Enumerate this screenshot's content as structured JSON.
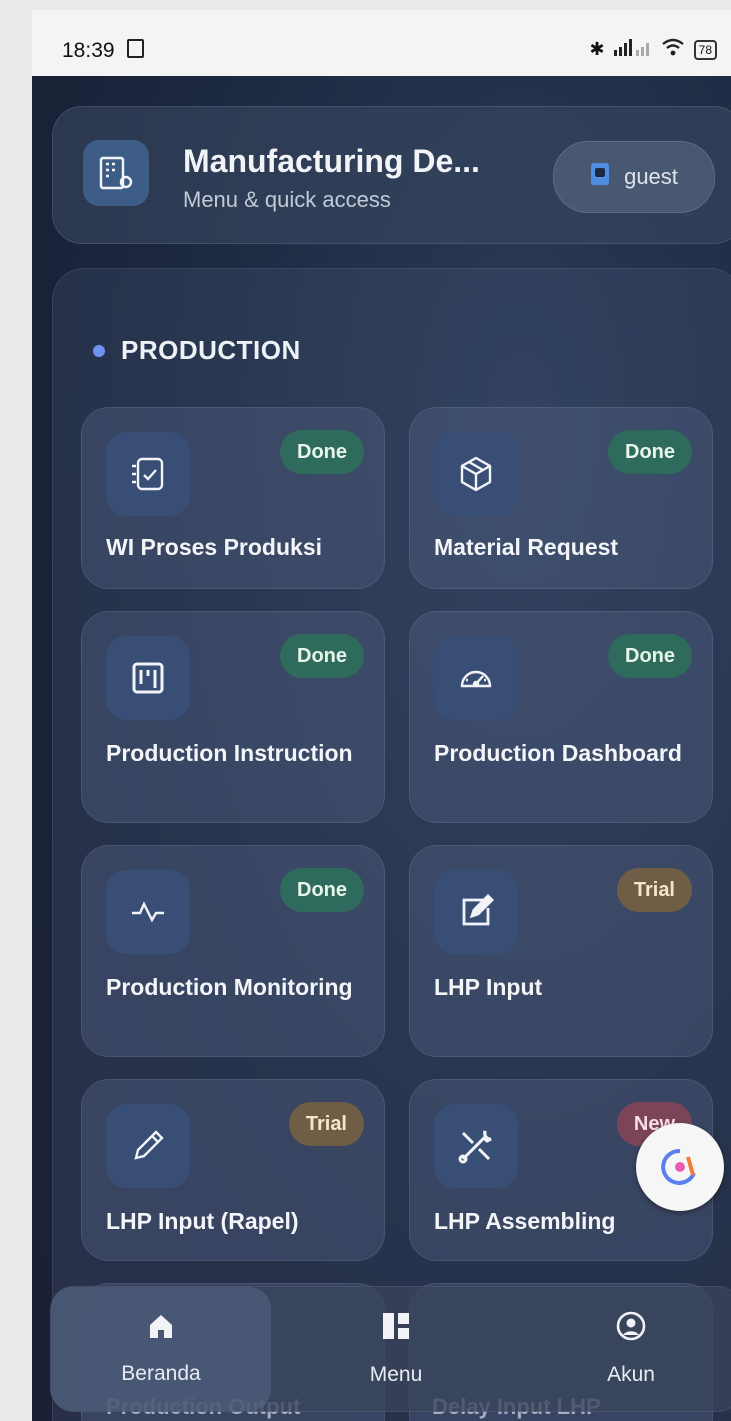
{
  "status_bar": {
    "time": "18:39",
    "battery": "78"
  },
  "header": {
    "title": "Manufacturing De...",
    "subtitle": "Menu & quick access",
    "user": "guest"
  },
  "section": {
    "title": "PRODUCTION"
  },
  "tiles": [
    {
      "label": "WI Proses Produksi",
      "badge": "Done",
      "badge_type": "done",
      "icon": "checklist-icon"
    },
    {
      "label": "Material Request",
      "badge": "Done",
      "badge_type": "done",
      "icon": "box-icon"
    },
    {
      "label": "Production Instruction",
      "badge": "Done",
      "badge_type": "done",
      "icon": "board-icon"
    },
    {
      "label": "Production Dashboard",
      "badge": "Done",
      "badge_type": "done",
      "icon": "gauge-icon"
    },
    {
      "label": "Production Monitoring",
      "badge": "Done",
      "badge_type": "done",
      "icon": "pulse-icon"
    },
    {
      "label": "LHP Input",
      "badge": "Trial",
      "badge_type": "trial",
      "icon": "edit-icon"
    },
    {
      "label": "LHP Input (Rapel)",
      "badge": "Trial",
      "badge_type": "trial",
      "icon": "pencil-icon"
    },
    {
      "label": "LHP Assembling",
      "badge": "New",
      "badge_type": "new",
      "icon": "tools-icon"
    }
  ],
  "peek_tiles": [
    "Production Output",
    "Delay Input LHP"
  ],
  "bottom_nav": {
    "home": "Beranda",
    "menu": "Menu",
    "account": "Akun"
  },
  "colors": {
    "accent": "#6f94f0",
    "done": "#2f6b5d",
    "trial": "#6f5e45",
    "new": "#7b4458"
  }
}
